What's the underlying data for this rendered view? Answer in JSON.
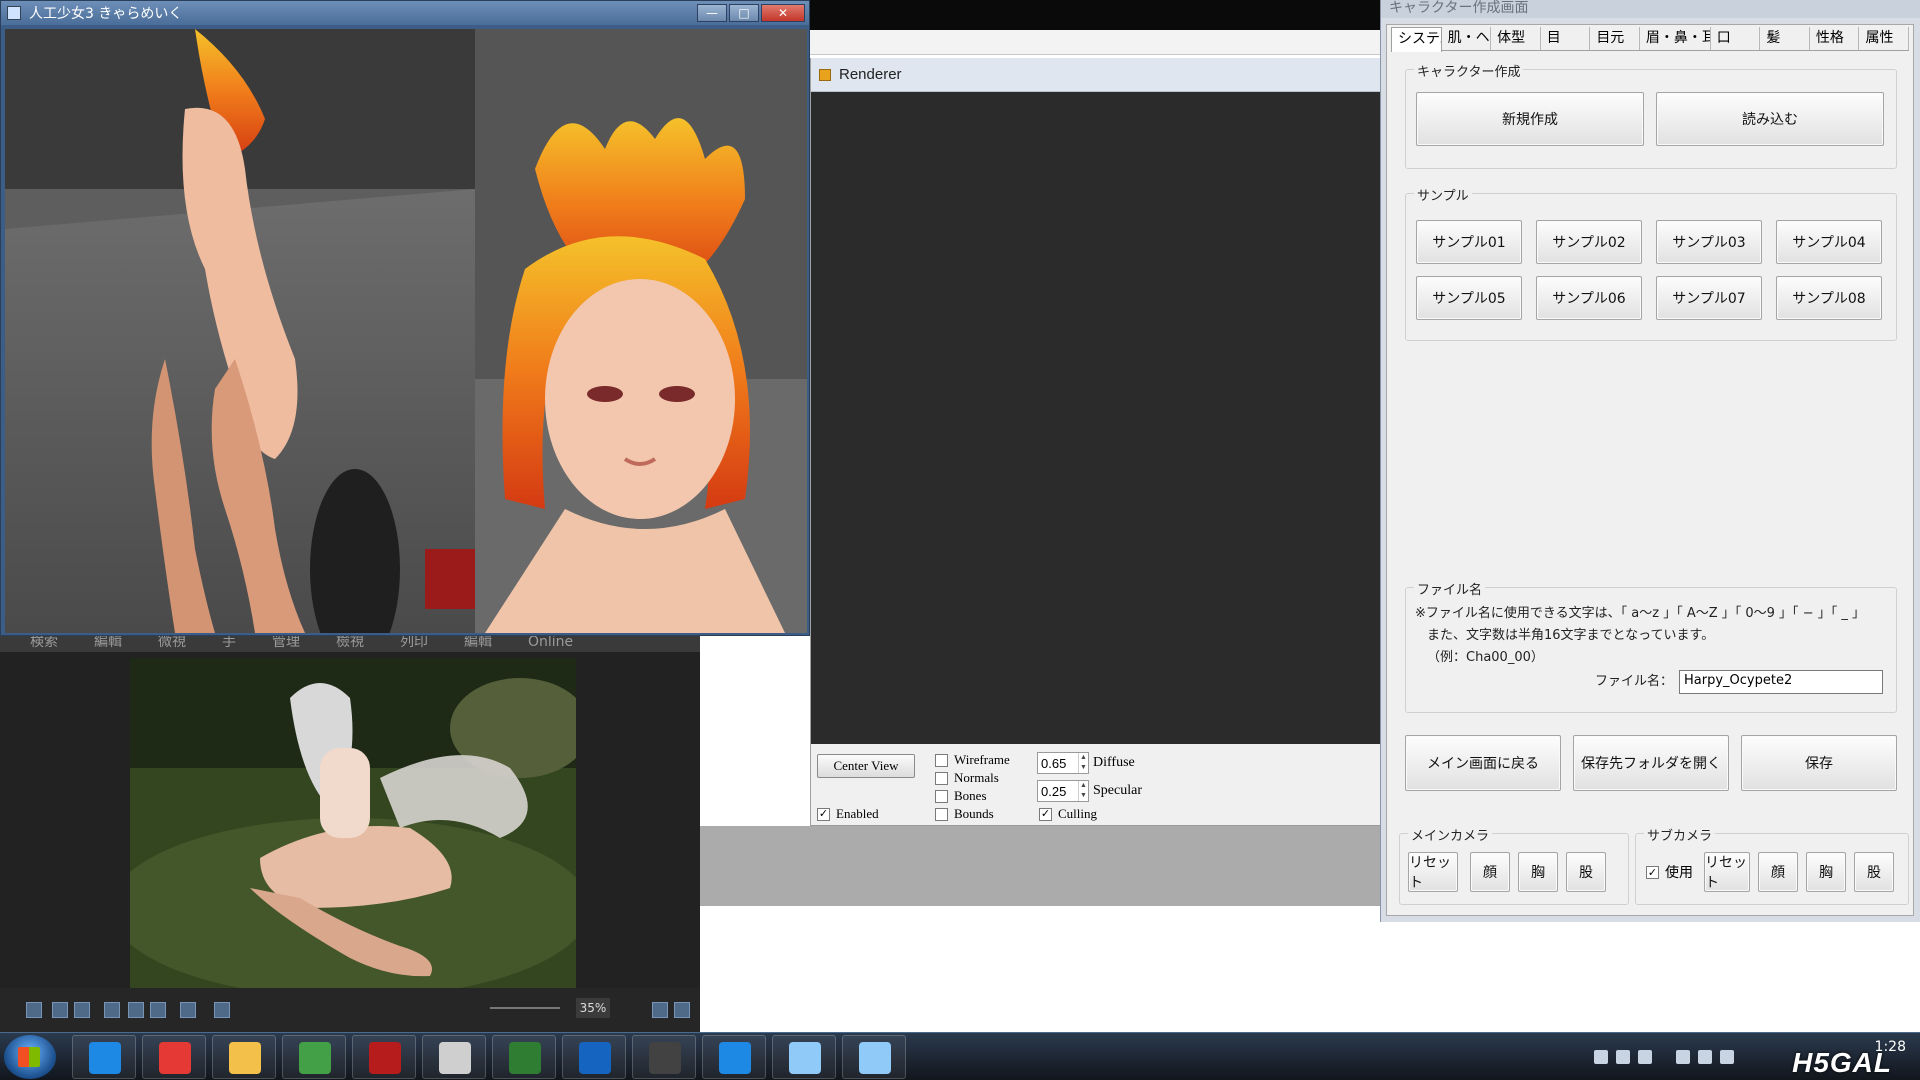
{
  "game_window": {
    "title": "人工少女3 きゃらめいく",
    "controls": [
      "—",
      "□",
      "✕"
    ]
  },
  "renderer": {
    "title": "Renderer",
    "center_view_label": "Center View",
    "checks": [
      {
        "label": "Wireframe",
        "checked": false
      },
      {
        "label": "Normals",
        "checked": false
      },
      {
        "label": "Bones",
        "checked": false
      },
      {
        "label": "Bounds",
        "checked": false
      },
      {
        "label": "Enabled",
        "checked": true
      },
      {
        "label": "Culling",
        "checked": true
      }
    ],
    "diffuse_value": "0.65",
    "diffuse_label": "Diffuse",
    "specular_value": "0.25",
    "specular_label": "Specular"
  },
  "viewer": {
    "tabs": [
      "検索",
      "編輯",
      "微視",
      "手",
      "管理",
      "檢視",
      "列印",
      "編輯",
      "Online"
    ],
    "zoom": "35%"
  },
  "panel": {
    "title": "キャラクター作成画面",
    "tabs": [
      "システム",
      "肌・ヘア",
      "体型",
      "目",
      "目元",
      "眉・鼻・耳",
      "口",
      "髪",
      "性格",
      "属性"
    ],
    "active_tab": "システム",
    "create_group": {
      "label": "キャラクター作成",
      "new_button": "新規作成",
      "load_button": "読み込む"
    },
    "sample_group": {
      "label": "サンプル",
      "buttons": [
        "サンプル01",
        "サンプル02",
        "サンプル03",
        "サンプル04",
        "サンプル05",
        "サンプル06",
        "サンプル07",
        "サンプル08"
      ]
    },
    "filename_group": {
      "label": "ファイル名",
      "note_line1": "※ファイル名に使用できる文字は、「 a〜z 」「 A〜Z 」「 0〜9 」「 − 」「 _ 」",
      "note_line2": "また、文字数は半角16文字までとなっています。",
      "note_line3": "（例：Cha00_00）",
      "field_label": "ファイル名：",
      "field_value": "Harpy_Ocypete2"
    },
    "actions": {
      "back": "メイン画面に戻る",
      "open_folder": "保存先フォルダを開く",
      "save": "保存"
    },
    "main_camera": {
      "label": "メインカメラ",
      "buttons": [
        "リセット",
        "顔",
        "胸",
        "股"
      ]
    },
    "sub_camera": {
      "label": "サブカメラ",
      "use_label": "使用",
      "use_checked": true,
      "buttons": [
        "リセット",
        "顔",
        "胸",
        "股"
      ]
    }
  },
  "taskbar": {
    "clock": "1:28",
    "watermark": "H5GAL",
    "apps": [
      {
        "name": "internet-explorer",
        "color": "#1e88e5"
      },
      {
        "name": "chrome",
        "color": "#e53935"
      },
      {
        "name": "file-explorer",
        "color": "#f3c14a"
      },
      {
        "name": "community-app",
        "color": "#43a047"
      },
      {
        "name": "red-app",
        "color": "#b71c1c"
      },
      {
        "name": "game-app",
        "color": "#cfcfcf"
      },
      {
        "name": "monitor-app",
        "color": "#2e7d32"
      },
      {
        "name": "windows-app",
        "color": "#1565c0"
      },
      {
        "name": "camera-app",
        "color": "#424242"
      },
      {
        "name": "windows-app-2",
        "color": "#1e88e5"
      },
      {
        "name": "disk-app",
        "color": "#90caf9"
      },
      {
        "name": "disk-app-2",
        "color": "#90caf9"
      }
    ]
  }
}
